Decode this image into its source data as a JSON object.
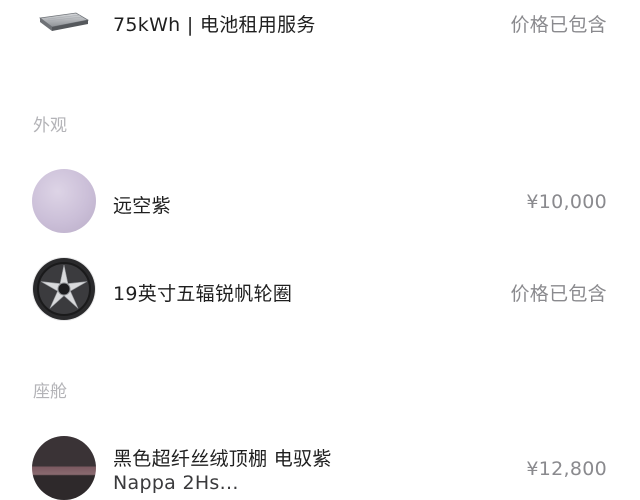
{
  "items": [
    {
      "name": "75kWh | 电池租用服务",
      "price": "价格已包含",
      "icon": "battery-pack-icon"
    },
    {
      "name": "远空紫",
      "price": "¥10,000",
      "icon": "color-swatch",
      "swatch_color": "#cbbfd8"
    },
    {
      "name": "19英寸五辐锐帆轮圈",
      "price": "价格已包含",
      "icon": "wheel-icon"
    },
    {
      "name_line1": "黑色超纤丝绒顶棚 电驭紫",
      "name_line2": "Nappa 2Hs...",
      "price": "¥12,800",
      "icon": "interior-thumbnail"
    }
  ],
  "sections": {
    "exterior": "外观",
    "cabin": "座舱"
  }
}
